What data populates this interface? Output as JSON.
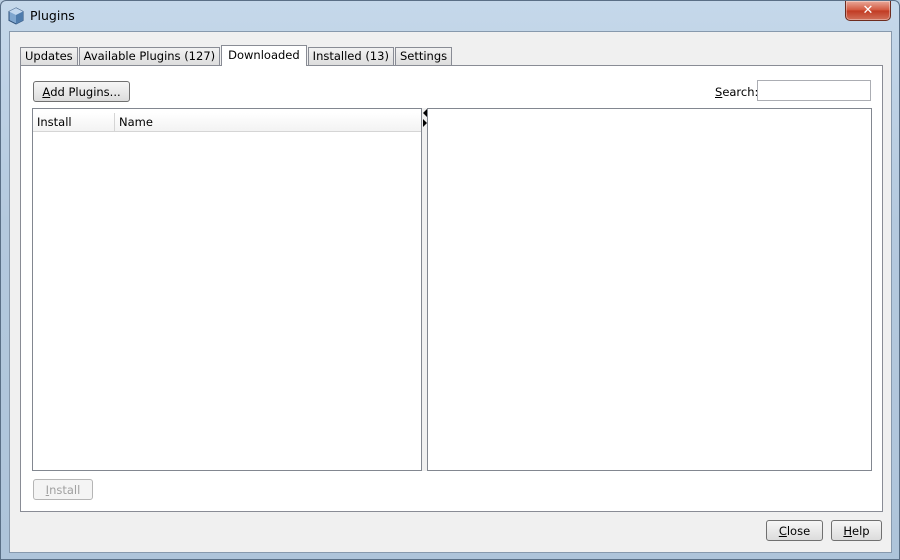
{
  "window": {
    "title": "Plugins",
    "close_glyph": "✕"
  },
  "tabs": [
    {
      "label": "Updates",
      "active": false
    },
    {
      "label": "Available Plugins (127)",
      "active": false
    },
    {
      "label": "Downloaded",
      "active": true
    },
    {
      "label": "Installed (13)",
      "active": false
    },
    {
      "label": "Settings",
      "active": false
    }
  ],
  "toolbar": {
    "add_plugins_mnemonic": "A",
    "add_plugins_rest": "dd Plugins...",
    "search_mnemonic": "S",
    "search_rest": "earch:",
    "search_value": ""
  },
  "table": {
    "columns": [
      "Install",
      "Name"
    ],
    "rows": []
  },
  "footer": {
    "install_mnemonic": "I",
    "install_rest": "nstall",
    "close_mnemonic": "C",
    "close_rest": "lose",
    "help_mnemonic": "H",
    "help_rest": "elp"
  },
  "icons": {
    "app": "netbeans-cube-icon"
  }
}
